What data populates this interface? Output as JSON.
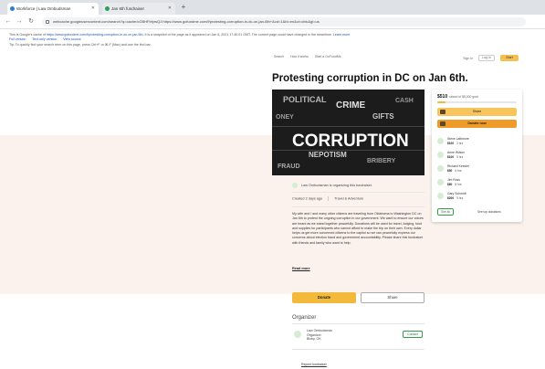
{
  "browser": {
    "tabs": [
      {
        "label": "Workforce | Law Ombudsman"
      },
      {
        "label": "Jan 6th fundraiser"
      }
    ],
    "newtab_glyph": "+",
    "address": "webcache.googleusercontent.com/search?q=cache:kGBHFbfyrsQJ:https://www.gofundme.com/f/protesting-corruption-in-dc-on-jan-6th+&cd=1&hl=en&ct=clnk&gl=us",
    "info_line_1": "This is Google's cache of",
    "info_line_1_link": "https://www.gofundme.com/f/protesting-corruption-in-dc-on-jan-6th",
    "info_line_1_rest": ". It is a snapshot of the page as it appeared on Jan 6, 2021 17:40:01 GMT. The current page could have changed in the meantime.",
    "info_learn_more": "Learn more.",
    "info_links": [
      "Full version",
      "Text-only version",
      "View source"
    ],
    "info_line_3": "Tip: To quickly find your search term on this page, press Ctrl+F or ⌘-F (Mac) and use the find bar."
  },
  "site": {
    "nav": [
      "Search",
      "How it works",
      "Start a GoFundMe"
    ],
    "signin": "Sign in",
    "hand": "Log in",
    "start": "Start"
  },
  "campaign": {
    "title": "Protesting corruption in DC on Jan 6th.",
    "hero_words": [
      "CORRUPTION",
      "POLITICAL",
      "CRIME",
      "ONEY",
      "GIFTS",
      "NEPOTISM",
      "BRIBERY",
      "FRAUD",
      "CASH"
    ],
    "organizer_line": "Law Ombudsman is organizing this fundraiser.",
    "created": "Created 2 days ago",
    "category": "Travel & Adventure",
    "story": "My wife and I and many other citizens are traveling from Oklahoma to Washington DC on Jan 6th to protest the ongoing corruption in our government. We want to ensure our voices are heard as we stand together peacefully. Donations will be used for travel, lodging, food and supplies for participants who cannot afford to make the trip on their own. Every dollar helps us get more concerned citizens to the capitol so we can peacefully express our concerns about election fraud and government accountability. Please share this fundraiser with friends and family who want to help.",
    "read_more": "Read more",
    "donate_label": "Donate",
    "share_label": "Share",
    "organizer_heading": "Organizer",
    "organizer_name": "Law Ombudsman",
    "organizer_role": "Organizer",
    "organizer_location": "Bixby, OK",
    "contact_label": "Contact",
    "report_label": "Report fundraiser"
  },
  "sidebar": {
    "amount": "$510",
    "goal": "raised of $5,000 goal",
    "progress": 0.1,
    "share_label": "Share",
    "donate_label": "Donate now",
    "donors": [
      {
        "name": "Steve Lattimore",
        "amount": "$100",
        "when": "2 hrs"
      },
      {
        "name": "Anne Wilson",
        "amount": "$100",
        "when": "5 hrs"
      },
      {
        "name": "Richard Kessler",
        "amount": "$50",
        "when": "6 hrs"
      },
      {
        "name": "Jim Ross",
        "amount": "$60",
        "when": "8 hrs"
      },
      {
        "name": "Gary Schmidt",
        "amount": "$200",
        "when": "9 hrs"
      }
    ],
    "see_all": "See all",
    "see_top": "See top donations"
  },
  "colors": {
    "accent": "#f2b93b",
    "donate_orange": "#ef9b2a",
    "green": "#3a9b4c",
    "peach_band": "#fbf2ed"
  }
}
